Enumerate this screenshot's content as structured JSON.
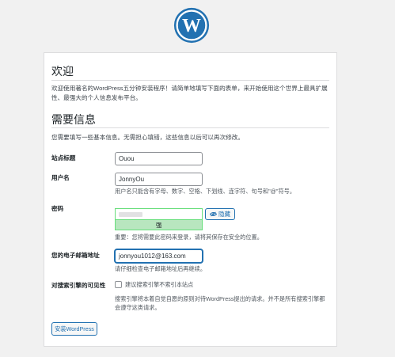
{
  "header": {
    "logo_icon": "wordpress-logo-icon",
    "brand_color": "#2271b1"
  },
  "welcome": {
    "title": "欢迎",
    "text": "欢迎使用著名的WordPress五分钟安装程序！请简单地填写下面的表单，来开始使用这个世界上最具扩展性、最强大的个人信息发布平台。"
  },
  "info": {
    "title": "需要信息",
    "text": "您需要填写一些基本信息。无需担心填错，这些信息以后可以再次修改。"
  },
  "fields": {
    "site_title": {
      "label": "站点标题",
      "value": "Ouou"
    },
    "username": {
      "label": "用户名",
      "value": "JonnyOu",
      "description": "用户名只能含有字母、数字、空格、下划线、连字符、句号和\"@\"符号。"
    },
    "password": {
      "label": "密码",
      "strength": "强",
      "hide_label": "隐藏",
      "hide_icon": "eye-slash-icon",
      "description": "重要：您将需要此密码来登录，请将其保存在安全的位置。"
    },
    "email": {
      "label": "您的电子邮箱地址",
      "value": "jonnyou1012@163.com",
      "description": "请仔细检查电子邮箱地址后再继续。"
    },
    "visibility": {
      "label": "对搜索引擎的可见性",
      "checkbox_label": "建议搜索引擎不索引本站点",
      "checked": false,
      "description": "搜索引擎将本着自觉自愿的原则对待WordPress提出的请求。并不是所有搜索引擎都会遵守这类请求。"
    }
  },
  "submit": {
    "label": "安装WordPress"
  }
}
